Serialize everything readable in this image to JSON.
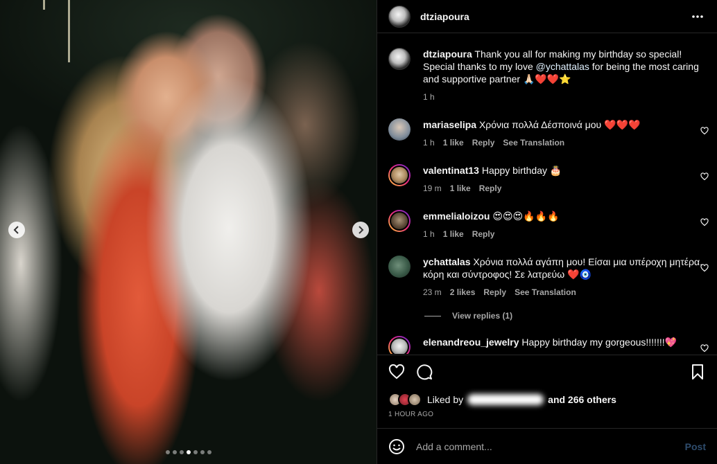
{
  "post": {
    "username": "dtziapoura",
    "caption": "Thank you all for making my birthday so special! Special thanks to my love",
    "caption_mention": "@ychattalas",
    "caption_tail": "for being the most caring and supportive partner 🙏🏻❤️❤️⭐️",
    "caption_time": "1 h"
  },
  "comments": [
    {
      "user": "mariaselipa",
      "text": "Χρόνια πολλά Δέσποινά μου ❤️❤️❤️",
      "time": "1 h",
      "likes": "1 like",
      "reply": "Reply",
      "translate": "See Translation"
    },
    {
      "user": "valentinat13",
      "text": "Happy birthday 🎂",
      "time": "19 m",
      "likes": "1 like",
      "reply": "Reply"
    },
    {
      "user": "emmelialoizou",
      "text": "😍😍😍🔥🔥🔥",
      "time": "1 h",
      "likes": "1 like",
      "reply": "Reply"
    },
    {
      "user": "ychattalas",
      "text": "Χρόνια πολλά αγάπη μου! Είσαι μια υπέροχη μητέρα, κόρη και σύντροφος! Σε λατρεύω ❤️🧿",
      "time": "23 m",
      "likes": "2 likes",
      "reply": "Reply",
      "translate": "See Translation"
    },
    {
      "user": "elenandreou_jewelry",
      "text": "Happy birthday my gorgeous!!!!!!!💖"
    }
  ],
  "view_replies": "View replies (1)",
  "likes": {
    "prefix": "Liked by",
    "tail": "and 266 others"
  },
  "time_ago": "1 HOUR AGO",
  "add_comment": {
    "placeholder": "Add a comment...",
    "post": "Post"
  },
  "carousel": {
    "count": 7,
    "active_index": 3
  },
  "colors": {
    "background": "#000000",
    "secondary_text": "#a8a8a8",
    "divider": "#262626",
    "post_disabled": "#2f4d6e"
  }
}
